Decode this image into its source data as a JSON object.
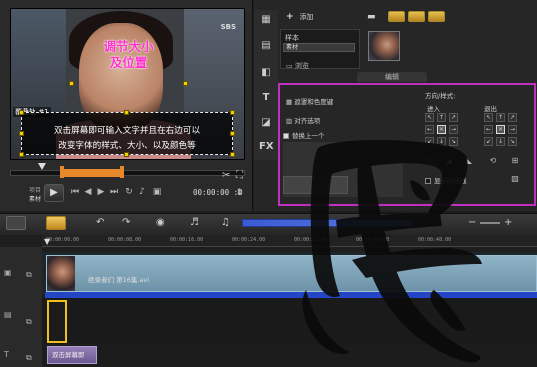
{
  "preview": {
    "title_text_line1": "调节大小",
    "title_text_line2": "及位置",
    "corner_label": "SBS",
    "track_tag": "覆叠轨 #1",
    "subtitle_line1": "双击屏幕即可输入文字并且在右边可以",
    "subtitle_line2": "改变字体的样式、大小、以及颜色等",
    "mode_label_project": "项目",
    "mode_label_clip": "素材",
    "timecode": "00:00:00 :0",
    "scrub_range_start": 0.22,
    "scrub_range_end": 0.48
  },
  "library": {
    "add_label": "添加",
    "combo_sample": "样本",
    "combo_media": "素材",
    "browse_label": "浏览",
    "edit_tab_label": "编辑"
  },
  "options": {
    "check_mask_label": "遮罩和色度键",
    "check_align_label": "对齐选项",
    "check_replace_label": "替换上一个",
    "direction_label": "方向/样式:",
    "enter_label": "进入",
    "exit_label": "退出",
    "grid_label": "显示网格线",
    "enter_grid": [
      "↖",
      "↑",
      "↗",
      "←",
      "✕",
      "→",
      "↙",
      "↓",
      "↘"
    ],
    "exit_grid": [
      "↖",
      "↑",
      "↗",
      "←",
      "✕",
      "→",
      "↙",
      "↓",
      "↘"
    ]
  },
  "timeline": {
    "ticks": [
      "00:00:00.00",
      "00:00:08.00",
      "00:00:16.00",
      "00:00:24.00",
      "00:00:32.00",
      "00:00:40.00",
      "00:00:48.00"
    ],
    "video_clip_name": "绝录者们 第16集.avi",
    "title_clip_name": "双击屏幕即"
  },
  "watermark": {
    "char": "民"
  }
}
